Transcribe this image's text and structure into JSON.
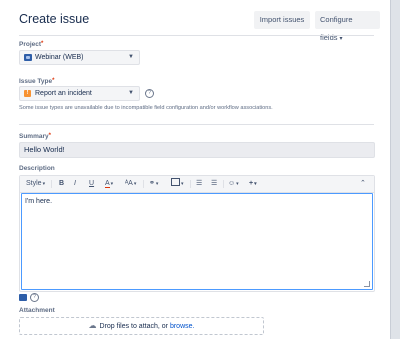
{
  "dialog": {
    "title": "Create issue",
    "import_label": "Import issues",
    "configure_label": "Configure fields"
  },
  "project": {
    "label": "Project",
    "value": "Webinar (WEB)",
    "icon": "project-icon"
  },
  "issue_type": {
    "label": "Issue Type",
    "value": "Report an incident",
    "icon": "incident-icon",
    "note": "Some issue types are unavailable due to incompatible field configuration and/or workflow associations."
  },
  "summary": {
    "label": "Summary",
    "value": "Hello World!"
  },
  "description": {
    "label": "Description",
    "value": "I'm here.",
    "toolbar": {
      "style": "Style",
      "bold": "B",
      "italic": "I",
      "underline": "U",
      "text_color": "A",
      "text_size": "ᴬA"
    }
  },
  "attachment": {
    "label": "Attachment",
    "drop_text": "Drop files to attach, or",
    "browse_link": "browse."
  },
  "colors": {
    "accent": "#4c9aff",
    "link": "#0052cc",
    "required": "#de350b"
  }
}
